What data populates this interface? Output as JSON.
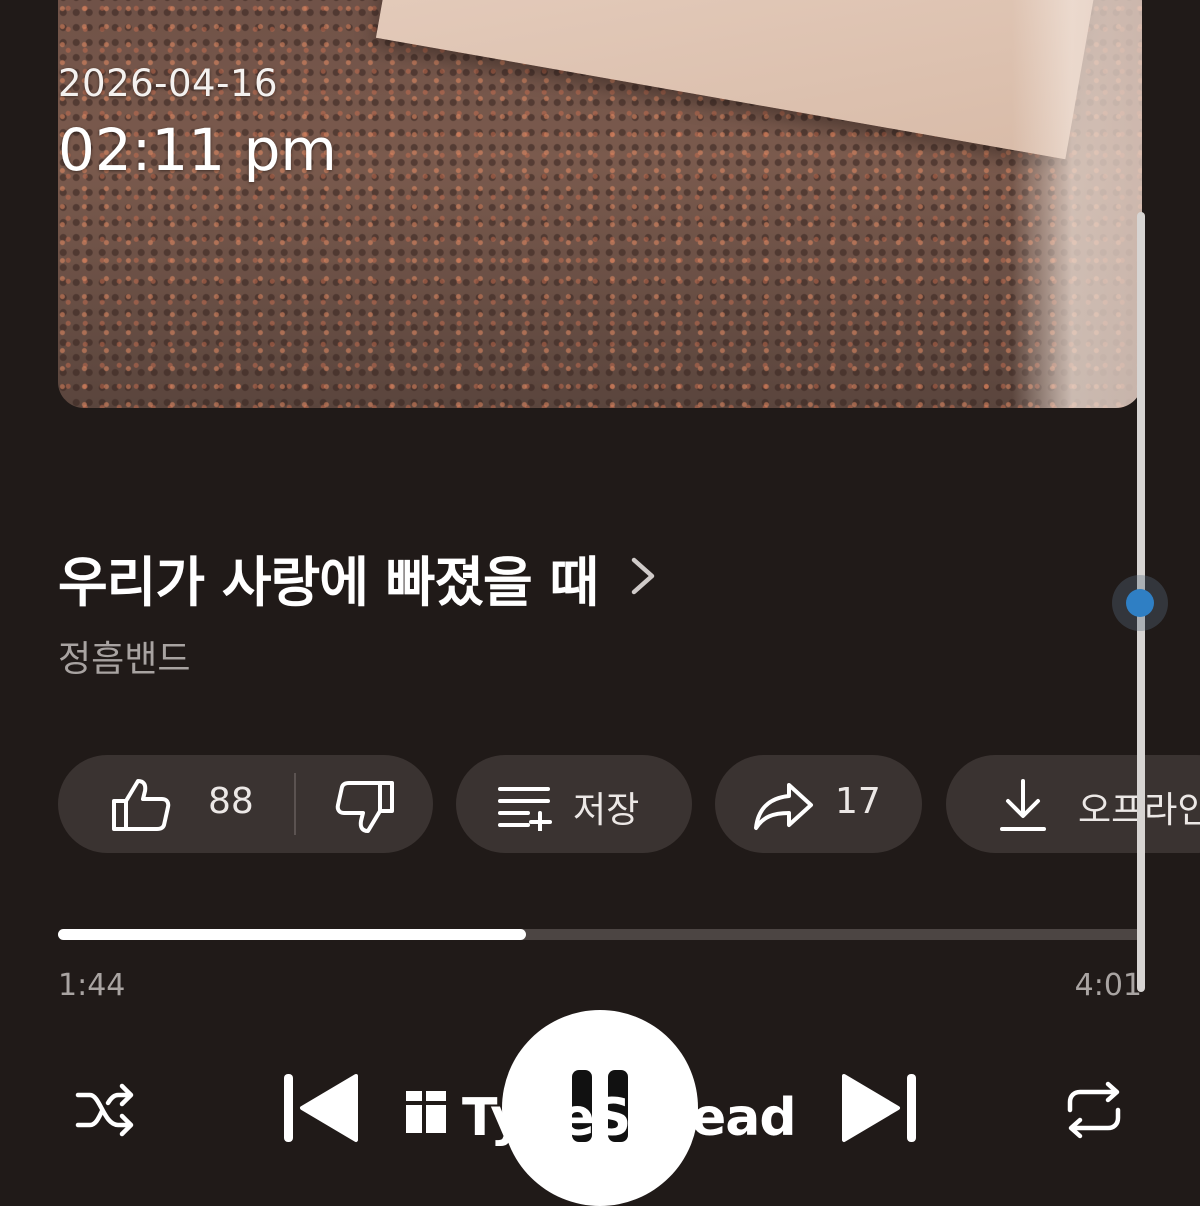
{
  "status": {
    "date": "2026-04-16",
    "time": "02:11 pm"
  },
  "song": {
    "title": "우리가 사랑에 빠졌을 때",
    "artist": "정흠밴드"
  },
  "actions": {
    "like_count": "88",
    "save_label": "저장",
    "share_count": "17",
    "offline_label": "오프라인"
  },
  "playback": {
    "elapsed": "1:44",
    "total": "4:01",
    "progress_fraction": 0.432
  },
  "watermark": {
    "text": "TypeSpread"
  },
  "icons": {
    "like": "thumbs-up-icon",
    "dislike": "thumbs-down-icon",
    "save": "playlist-add-icon",
    "share": "share-arrow-icon",
    "offline": "download-icon",
    "shuffle": "shuffle-icon",
    "previous": "skip-previous-icon",
    "pause": "pause-icon",
    "next": "skip-next-icon",
    "repeat": "repeat-icon",
    "chevron": "chevron-right-icon"
  },
  "colors": {
    "background": "#201a18",
    "pill": "#3a3331",
    "scroll_thumb": "#2f7fc4"
  }
}
